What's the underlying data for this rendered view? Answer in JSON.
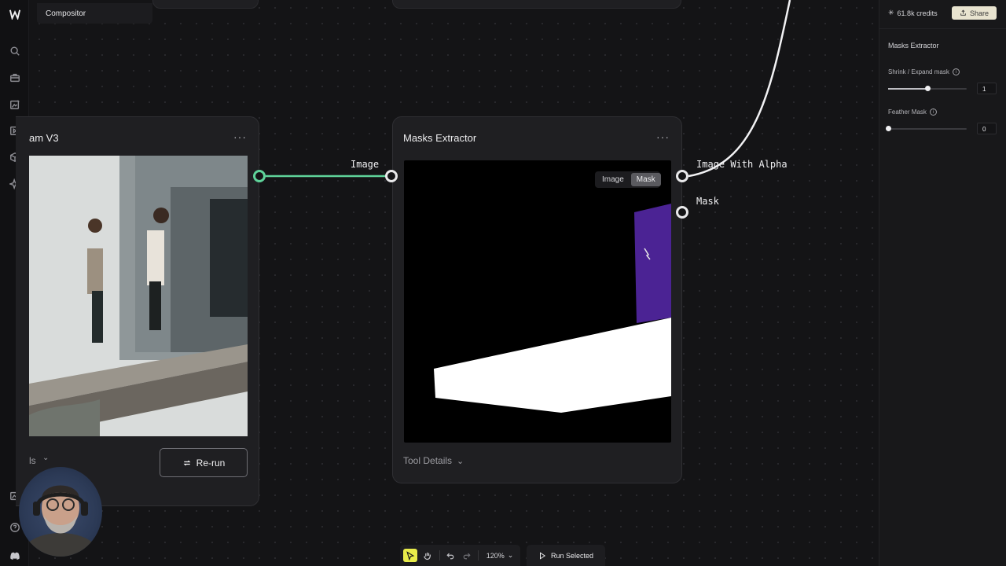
{
  "app": {
    "tab_title": "Compositor"
  },
  "left_rail": {
    "icons": [
      "logo-icon",
      "search-icon",
      "briefcase-icon",
      "image-edit-icon",
      "video-icon",
      "cube-icon",
      "sparkle-icon",
      "gallery-icon",
      "help-icon",
      "discord-icon"
    ]
  },
  "nodes": {
    "left": {
      "title": "am V3",
      "menu": "···",
      "details_label": "ls",
      "rerun_label": "Re-run"
    },
    "masks": {
      "title": "Masks Extractor",
      "menu": "···",
      "view_toggle": [
        "Image",
        "Mask"
      ],
      "active_view": "Mask",
      "tool_details_label": "Tool Details"
    }
  },
  "ports": {
    "left_output": "Image",
    "masks_input": "Image",
    "masks_output_1": "Image With Alpha",
    "masks_output_2": "Mask"
  },
  "right_panel": {
    "credits": "61.8k credits",
    "share_label": "Share",
    "section_title": "Masks Extractor",
    "shrink_label": "Shrink / Expand mask",
    "shrink_value": "1",
    "shrink_level": 0.5,
    "feather_label": "Feather Mask",
    "feather_value": "0",
    "feather_level": 0.0
  },
  "toolbar": {
    "zoom": "120%",
    "run_selected": "Run Selected"
  },
  "colors": {
    "accent_green": "#5fd39a",
    "share_bg": "#e8e3cf",
    "select_tool": "#e8ec4a",
    "mask_purple": "#4b2394"
  }
}
